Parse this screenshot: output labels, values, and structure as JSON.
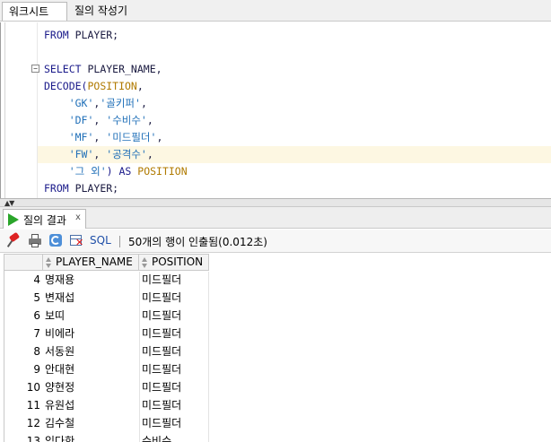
{
  "tabs": {
    "worksheet": "워크시트",
    "query_builder": "질의 작성기"
  },
  "editor": {
    "lines": [
      {
        "segs": [
          {
            "t": "FROM",
            "c": "kw"
          },
          {
            "t": " PLAYER;",
            "c": ""
          }
        ]
      },
      {
        "segs": [
          {
            "t": "",
            "c": ""
          }
        ]
      },
      {
        "segs": [
          {
            "t": "SELECT",
            "c": "kw"
          },
          {
            "t": " PLAYER_NAME,",
            "c": ""
          }
        ]
      },
      {
        "segs": [
          {
            "t": "DECODE(",
            "c": "kw"
          },
          {
            "t": "POSITION",
            "c": "col"
          },
          {
            "t": ",",
            "c": ""
          }
        ]
      },
      {
        "segs": [
          {
            "t": "    ",
            "c": ""
          },
          {
            "t": "'GK'",
            "c": "str"
          },
          {
            "t": ",",
            "c": ""
          },
          {
            "t": "'골키퍼'",
            "c": "str"
          },
          {
            "t": ",",
            "c": ""
          }
        ]
      },
      {
        "segs": [
          {
            "t": "    ",
            "c": ""
          },
          {
            "t": "'DF'",
            "c": "str"
          },
          {
            "t": ", ",
            "c": ""
          },
          {
            "t": "'수비수'",
            "c": "str"
          },
          {
            "t": ",",
            "c": ""
          }
        ]
      },
      {
        "segs": [
          {
            "t": "    ",
            "c": ""
          },
          {
            "t": "'MF'",
            "c": "str"
          },
          {
            "t": ", ",
            "c": ""
          },
          {
            "t": "'미드필더'",
            "c": "str"
          },
          {
            "t": ",",
            "c": ""
          }
        ]
      },
      {
        "segs": [
          {
            "t": "    ",
            "c": ""
          },
          {
            "t": "'FW'",
            "c": "str"
          },
          {
            "t": ", ",
            "c": ""
          },
          {
            "t": "'공격수'",
            "c": "str"
          },
          {
            "t": ",",
            "c": ""
          }
        ]
      },
      {
        "segs": [
          {
            "t": "    ",
            "c": ""
          },
          {
            "t": "'그 외'",
            "c": "str"
          },
          {
            "t": ") AS ",
            "c": "kw"
          },
          {
            "t": "POSITION",
            "c": "col"
          }
        ]
      },
      {
        "segs": [
          {
            "t": "FROM",
            "c": "kw"
          },
          {
            "t": " PLAYER;",
            "c": ""
          }
        ]
      }
    ],
    "highlighted_line": 7
  },
  "result_tab": {
    "label": "질의 결과",
    "close": "x"
  },
  "toolbar": {
    "sql_label": "SQL",
    "status": "50개의 행이 인출됨(0.012초)"
  },
  "grid": {
    "columns": [
      "PLAYER_NAME",
      "POSITION"
    ],
    "rows": [
      {
        "n": "4",
        "name": "명재용",
        "pos": "미드필더"
      },
      {
        "n": "5",
        "name": "변재섭",
        "pos": "미드필더"
      },
      {
        "n": "6",
        "name": "보띠",
        "pos": "미드필더"
      },
      {
        "n": "7",
        "name": "비에라",
        "pos": "미드필더"
      },
      {
        "n": "8",
        "name": "서동원",
        "pos": "미드필더"
      },
      {
        "n": "9",
        "name": "안대현",
        "pos": "미드필더"
      },
      {
        "n": "10",
        "name": "양현정",
        "pos": "미드필더"
      },
      {
        "n": "11",
        "name": "유원섭",
        "pos": "미드필더"
      },
      {
        "n": "12",
        "name": "김수철",
        "pos": "미드필더"
      },
      {
        "n": "13",
        "name": "임다한",
        "pos": "수비수"
      }
    ]
  },
  "colors": {
    "keyword": "#1a1a8a",
    "string": "#1f6fb8",
    "column": "#b07a00",
    "highlight": "#fdf7e2"
  }
}
